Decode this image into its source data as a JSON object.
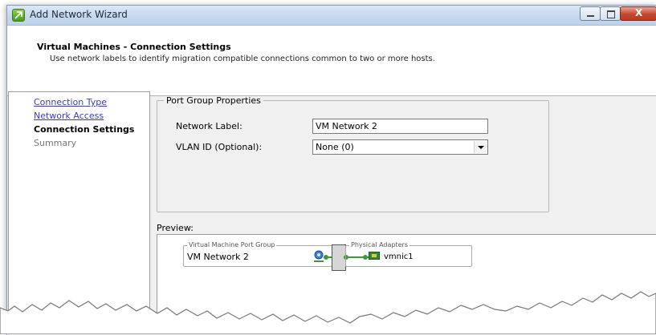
{
  "window": {
    "title": "Add Network Wizard",
    "close_glyph": "X"
  },
  "header": {
    "title": "Virtual Machines - Connection Settings",
    "subtitle": "Use network labels to identify migration compatible connections common to two or more hosts."
  },
  "nav": {
    "items": [
      {
        "label": "Connection Type",
        "state": "link"
      },
      {
        "label": "Network Access",
        "state": "link"
      },
      {
        "label": "Connection Settings",
        "state": "current"
      },
      {
        "label": "Summary",
        "state": "disabled"
      }
    ]
  },
  "port_group": {
    "legend": "Port Group Properties",
    "network_label_caption": "Network Label:",
    "network_label_value": "VM Network 2",
    "vlan_caption": "VLAN ID (Optional):",
    "vlan_value": "None (0)"
  },
  "preview": {
    "label": "Preview:",
    "vm_group_caption": "Virtual Machine Port Group",
    "vm_group_name": "VM Network 2",
    "physical_caption": "Physical Adapters",
    "adapter_name": "vmnic1"
  },
  "icons": {
    "app": "network-wizard-icon",
    "vm_network": "vm-network-icon",
    "adapter": "physical-nic-icon"
  },
  "colors": {
    "link": "#3a39c8",
    "connector": "#3a9a3a"
  }
}
